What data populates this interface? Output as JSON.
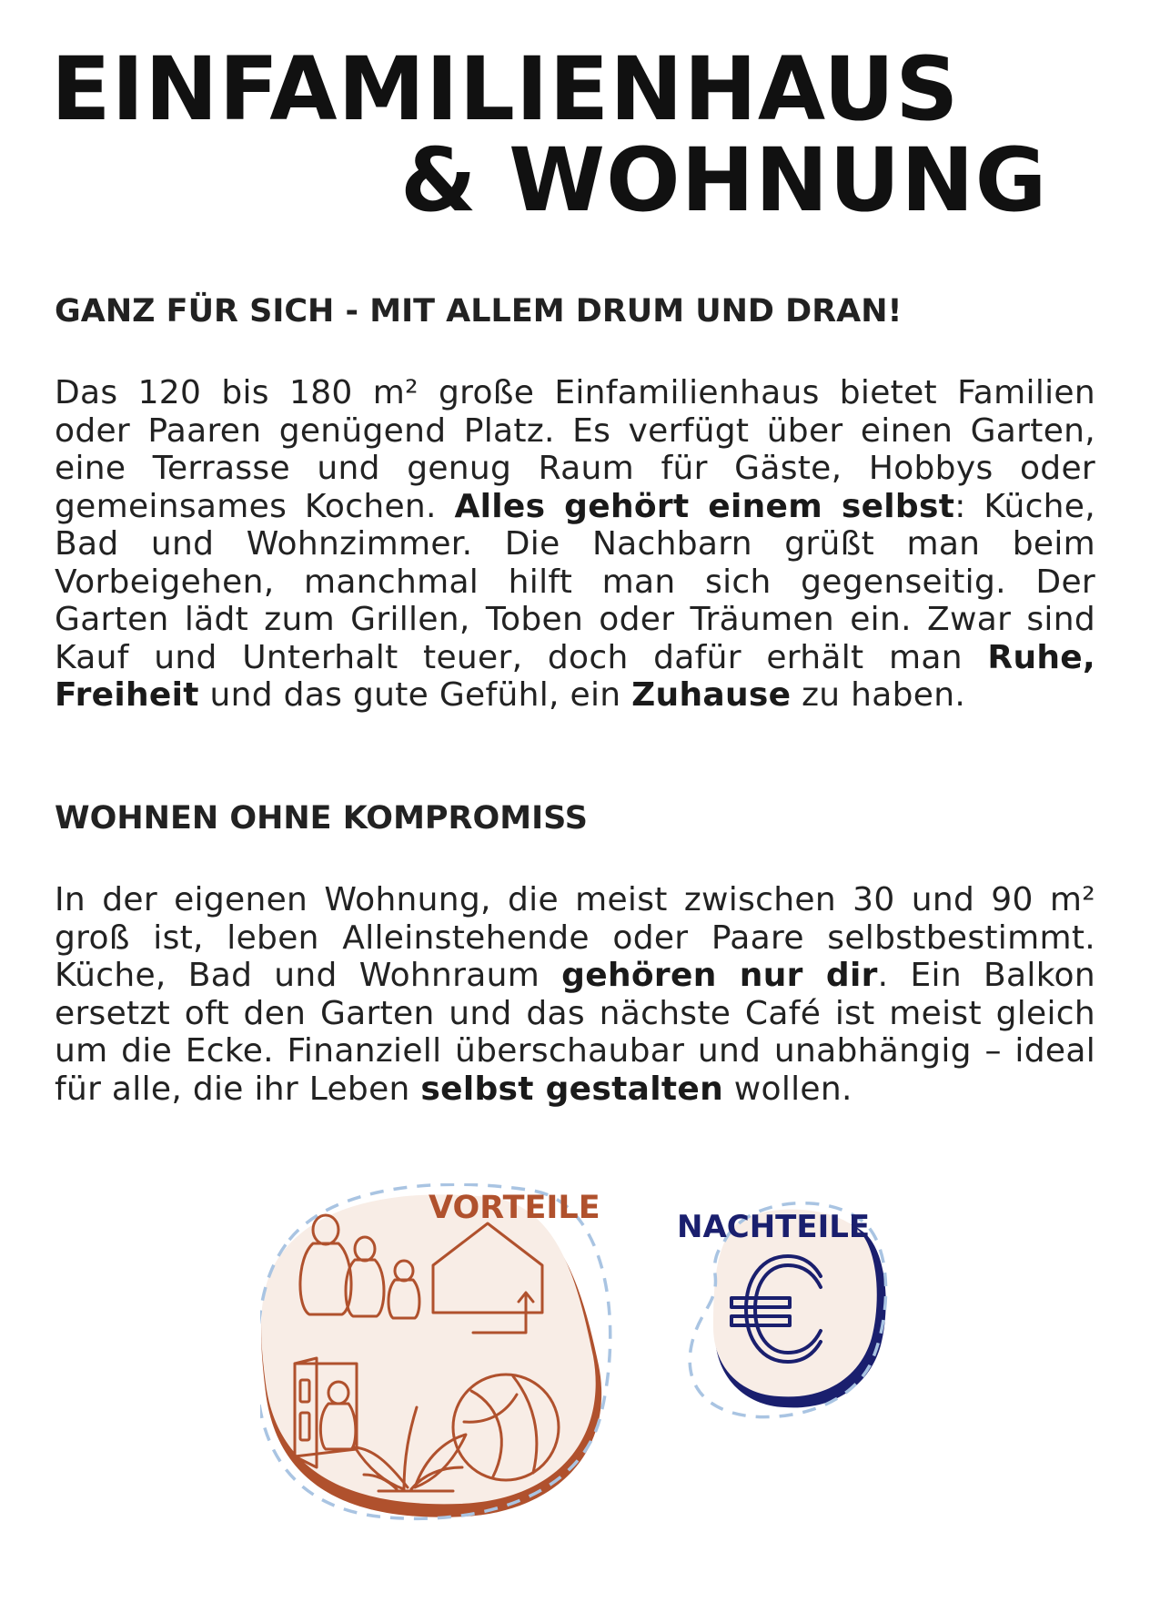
{
  "title": {
    "line1": "EINFAMILIENHAUS",
    "line2": "& WOHNUNG"
  },
  "section1": {
    "heading": "GANZ FÜR SICH - MIT ALLEM DRUM UND DRAN!",
    "p_a": "Das 120 bis 180 m² große Einfamilienhaus bietet Familien oder Paaren genügend Platz. Es verfügt über einen Garten, eine Terrasse und genug Raum für Gäste, Hobbys oder gemeinsames Kochen. ",
    "p_b": "Alles gehört einem selbst",
    "p_c": ": Küche, Bad und Wohnzimmer. Die Nachbarn grüßt man beim Vorbeigehen, manchmal hilft man sich gegenseitig. Der Garten lädt zum Grillen, Toben oder Träumen ein. Zwar sind Kauf und Unterhalt teuer, doch dafür erhält man ",
    "p_d": "Ruhe, Freiheit",
    "p_e": " und das gute Gefühl, ein ",
    "p_f": "Zuhause",
    "p_g": " zu haben."
  },
  "section2": {
    "heading": "WOHNEN OHNE KOMPROMISS",
    "p_a": "In der eigenen Wohnung, die meist zwischen 30 und 90 m² groß ist, leben Alleinstehende oder Paare selbstbestimmt. Küche, Bad und Wohnraum ",
    "p_b": "gehören nur dir",
    "p_c": ". Ein Balkon ersetzt oft den Garten und das nächste Café ist meist gleich um die Ecke. Finanziell überschaubar und unabhängig – ideal für alle, die ihr Leben ",
    "p_d": "selbst gestalten",
    "p_e": " wollen."
  },
  "badges": {
    "vorteile": {
      "label": "VORTEILE",
      "color": "#b0512d",
      "fill": "#f8ede6",
      "icons": [
        "family-icon",
        "house-icon",
        "door-icon",
        "plant-icon",
        "ball-icon"
      ]
    },
    "nachteile": {
      "label": "NACHTEILE",
      "color": "#1a1f6e",
      "fill": "#f8ede6",
      "icons": [
        "euro-icon"
      ]
    },
    "dash_color": "#a9c4e2"
  }
}
